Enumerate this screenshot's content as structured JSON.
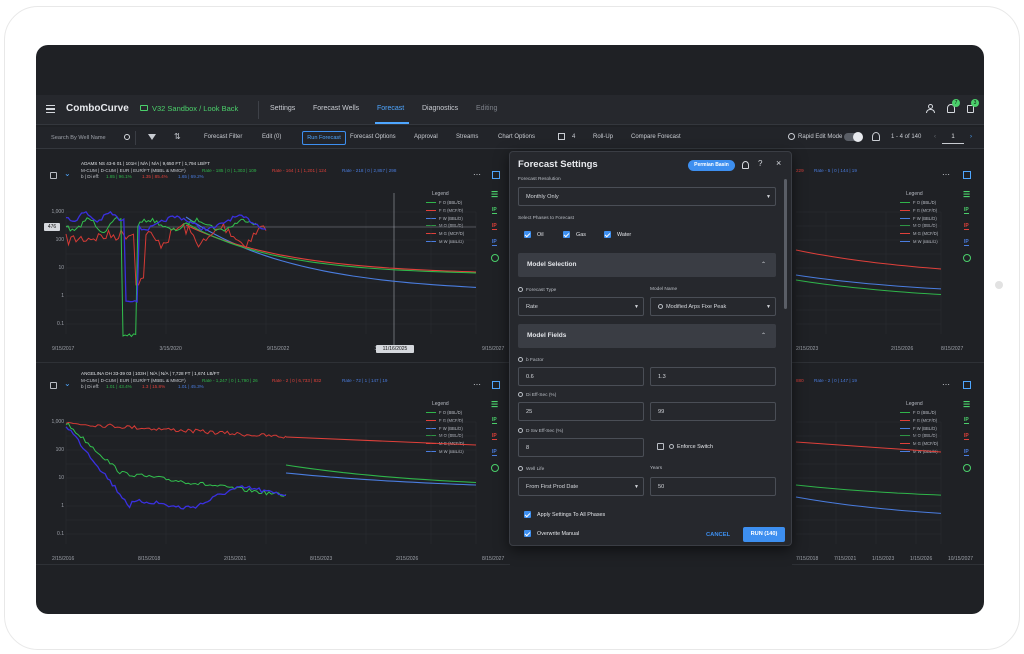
{
  "app": {
    "brand": "ComboCurve",
    "project": "V32 Sandbox / Look Back",
    "nav": [
      "Settings",
      "Forecast Wells",
      "Forecast",
      "Diagnostics",
      "Editing"
    ],
    "active_nav": "Forecast",
    "notif_badges": [
      "7",
      "3"
    ]
  },
  "toolbar": {
    "search_placeholder": "Search By Well Name",
    "forecast_filter": "Forecast Filter",
    "edit": "Edit (0)",
    "run_forecast": "Run Forecast",
    "forecast_options": "Forecast Options",
    "approval": "Approval",
    "streams": "Streams",
    "chart_options": "Chart Options",
    "chart_count": "4",
    "rollup": "Roll-Up",
    "compare": "Compare Forecast",
    "rapid_edit": "Rapid Edit Mode",
    "pagination": "1 - 4 of 140",
    "page": "1"
  },
  "colors": {
    "oil": "#2fb54a",
    "gas": "#e0403a",
    "water": "#4a7de0",
    "oil_dark": "#32c04e",
    "gas_dark": "#d63a35",
    "water_dark": "#3a30e0",
    "accent": "#3d8ff0"
  },
  "panels": [
    {
      "title": "ADAMS NS 43-6 01 | 101H | N/A | N/A | 9,650 FT | 1,794 LB/FT",
      "line2": "M-CUM | D-CUM | EUR | EUR/FT (MBBL & MMCF)",
      "line2b": "Rate - 185 | 0 | 1,303 | 109",
      "line2c": "Rate - 164 | 1 | 1,201 | 124",
      "line2d": "Rate - 218 | 0 | 2,857 | 298",
      "line3": "b | Di eff:",
      "line3b": "1.85 | 96.1%",
      "line3c": "1.35 | 85.4%",
      "line3d": "1.65 | 69.2%",
      "yticks": [
        "1,000",
        "100",
        "10",
        "1",
        "0.1"
      ],
      "ymarker": "476",
      "xticks": [
        "9/15/2017",
        "3/15/2020",
        "9/15/2022",
        "3/15/20",
        "9/15/2027"
      ],
      "cursor_date": "11/16/2025"
    },
    {
      "title": "ANGELINA DH 33-39 03 | 103H | N/A | N/A | 7,728 FT | 1,674 LB/FT",
      "line2": "M-CUM | D-CUM | EUR | EUR/FT (MBBL & MMCF)",
      "line2b": "Rate - 1,247 | 0 | 1,790 | 26",
      "line2c": "Rate - 2 | 0 | 6,733 | 832",
      "line2d": "Rate - 72 | 1 | 147 | 19",
      "line3": "b | Di eff:",
      "line3b": "1.01 | 43.4%",
      "line3c": "1.3 | 15.8%",
      "line3d": "1.01 | 45.3%",
      "yticks": [
        "1,000",
        "100",
        "10",
        "1",
        "0.1"
      ],
      "xticks": [
        "2/15/2016",
        "8/15/2018",
        "2/15/2021",
        "8/15/2023",
        "2/15/2026",
        "8/15/2027"
      ]
    }
  ],
  "right_panels": [
    {
      "rates": [
        "229",
        "Rate - 5 | 0 | 144 | 19"
      ],
      "xticks": [
        "2/15/2023",
        "2/15/2026",
        "8/15/2027"
      ]
    },
    {
      "rates": [
        "880",
        "Rate - 2 | 0 | 147 | 19"
      ],
      "xticks": [
        "7/15/2018",
        "7/15/2021",
        "1/15/2023",
        "1/15/2026",
        "10/15/2027"
      ]
    }
  ],
  "legend": {
    "title": "Legend",
    "items": [
      "F O (BBL/D)",
      "F G (MCF/D)",
      "F W (BBL/D)",
      "M O (BBL/D)",
      "M G (MCF/D)",
      "M W (BBL/D)"
    ]
  },
  "side_icons": [
    "IP",
    "IP",
    "IP"
  ],
  "modal": {
    "title": "Forecast Settings",
    "badge": "Permian Basin",
    "resolution_label": "Forecast Resolution",
    "resolution": "Monthly Only",
    "phases_label": "Select Phases to Forecast",
    "phases": [
      "Oil",
      "Gas",
      "Water"
    ],
    "model_selection": "Model Selection",
    "forecast_type_label": "Forecast Type",
    "forecast_type": "Rate",
    "model_name_label": "Model Name",
    "model_name": "Modified Arps Fixe Peak",
    "model_fields": "Model Fields",
    "b_factor_label": "b Factor",
    "b_min": "0.6",
    "b_max": "1.3",
    "di_label": "Di Eff-Sec (%)",
    "di_min": "25",
    "di_max": "99",
    "d_label": "D Sw Eff-Sec (%)",
    "d_val": "8",
    "enforce_switch": "Enforce Switch",
    "well_life_label": "Well Life",
    "years_label": "Years",
    "well_life": "From First Prod Date",
    "years": "50",
    "apply_all": "Apply Settings To All Phases",
    "overwrite": "Overwrite Manual",
    "cancel": "CANCEL",
    "run": "RUN (140)"
  }
}
